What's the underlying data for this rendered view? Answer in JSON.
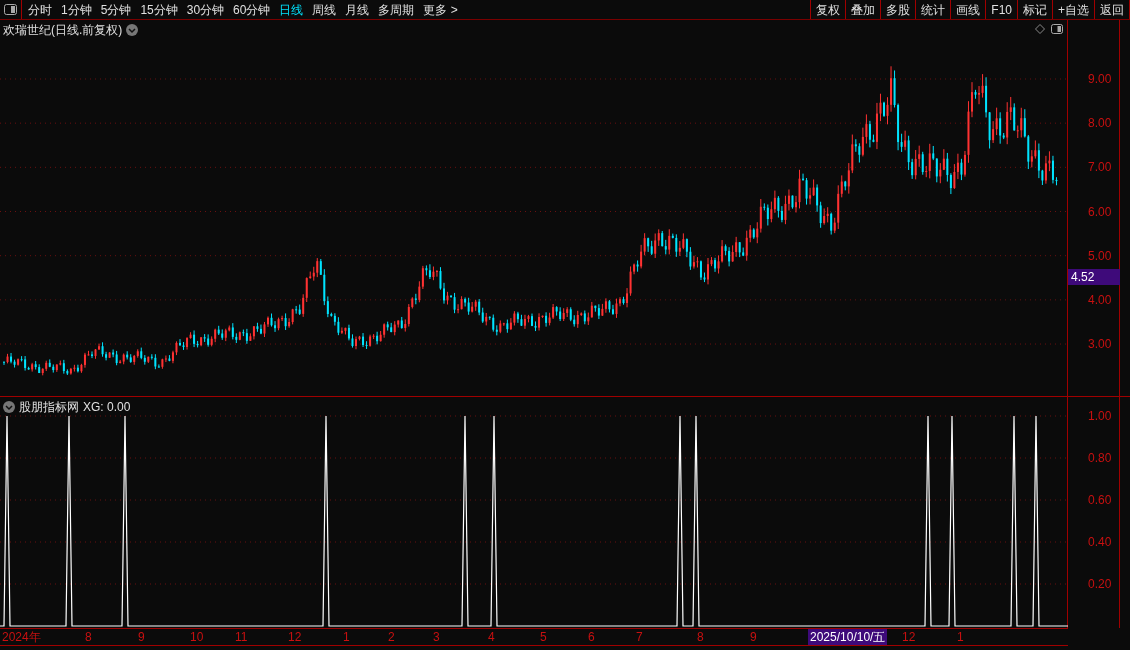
{
  "toolbar": {
    "periods": [
      {
        "label": "分时",
        "selected": false
      },
      {
        "label": "1分钟",
        "selected": false
      },
      {
        "label": "5分钟",
        "selected": false
      },
      {
        "label": "15分钟",
        "selected": false
      },
      {
        "label": "30分钟",
        "selected": false
      },
      {
        "label": "60分钟",
        "selected": false
      },
      {
        "label": "日线",
        "selected": true
      },
      {
        "label": "周线",
        "selected": false
      },
      {
        "label": "月线",
        "selected": false
      },
      {
        "label": "多周期",
        "selected": false
      }
    ],
    "more": "更多 >",
    "buttons": [
      "复权",
      "叠加",
      "多股",
      "统计",
      "画线",
      "F10",
      "标记",
      "+自选",
      "返回"
    ]
  },
  "price_chart": {
    "title": "欢瑞世纪(日线.前复权)",
    "ticks": [
      "9.00",
      "8.00",
      "7.00",
      "6.00",
      "5.00",
      "4.00",
      "3.00"
    ],
    "current_price": "4.52"
  },
  "indicator": {
    "title": "股朋指标网",
    "reading": "XG: 0.00",
    "ticks": [
      "1.00",
      "0.80",
      "0.60",
      "0.40",
      "0.20"
    ]
  },
  "date_axis": [
    {
      "label": "2024年",
      "selected": false
    },
    {
      "label": "8",
      "selected": false
    },
    {
      "label": "9",
      "selected": false
    },
    {
      "label": "10",
      "selected": false
    },
    {
      "label": "11",
      "selected": false
    },
    {
      "label": "12",
      "selected": false
    },
    {
      "label": "1",
      "selected": false
    },
    {
      "label": "2",
      "selected": false
    },
    {
      "label": "3",
      "selected": false
    },
    {
      "label": "4",
      "selected": false
    },
    {
      "label": "5",
      "selected": false
    },
    {
      "label": "6",
      "selected": false
    },
    {
      "label": "7",
      "selected": false
    },
    {
      "label": "8",
      "selected": false
    },
    {
      "label": "9",
      "selected": false
    },
    {
      "label": "2025/10/10/五",
      "selected": true
    },
    {
      "label": "12",
      "selected": false
    },
    {
      "label": "1",
      "selected": false
    }
  ]
}
